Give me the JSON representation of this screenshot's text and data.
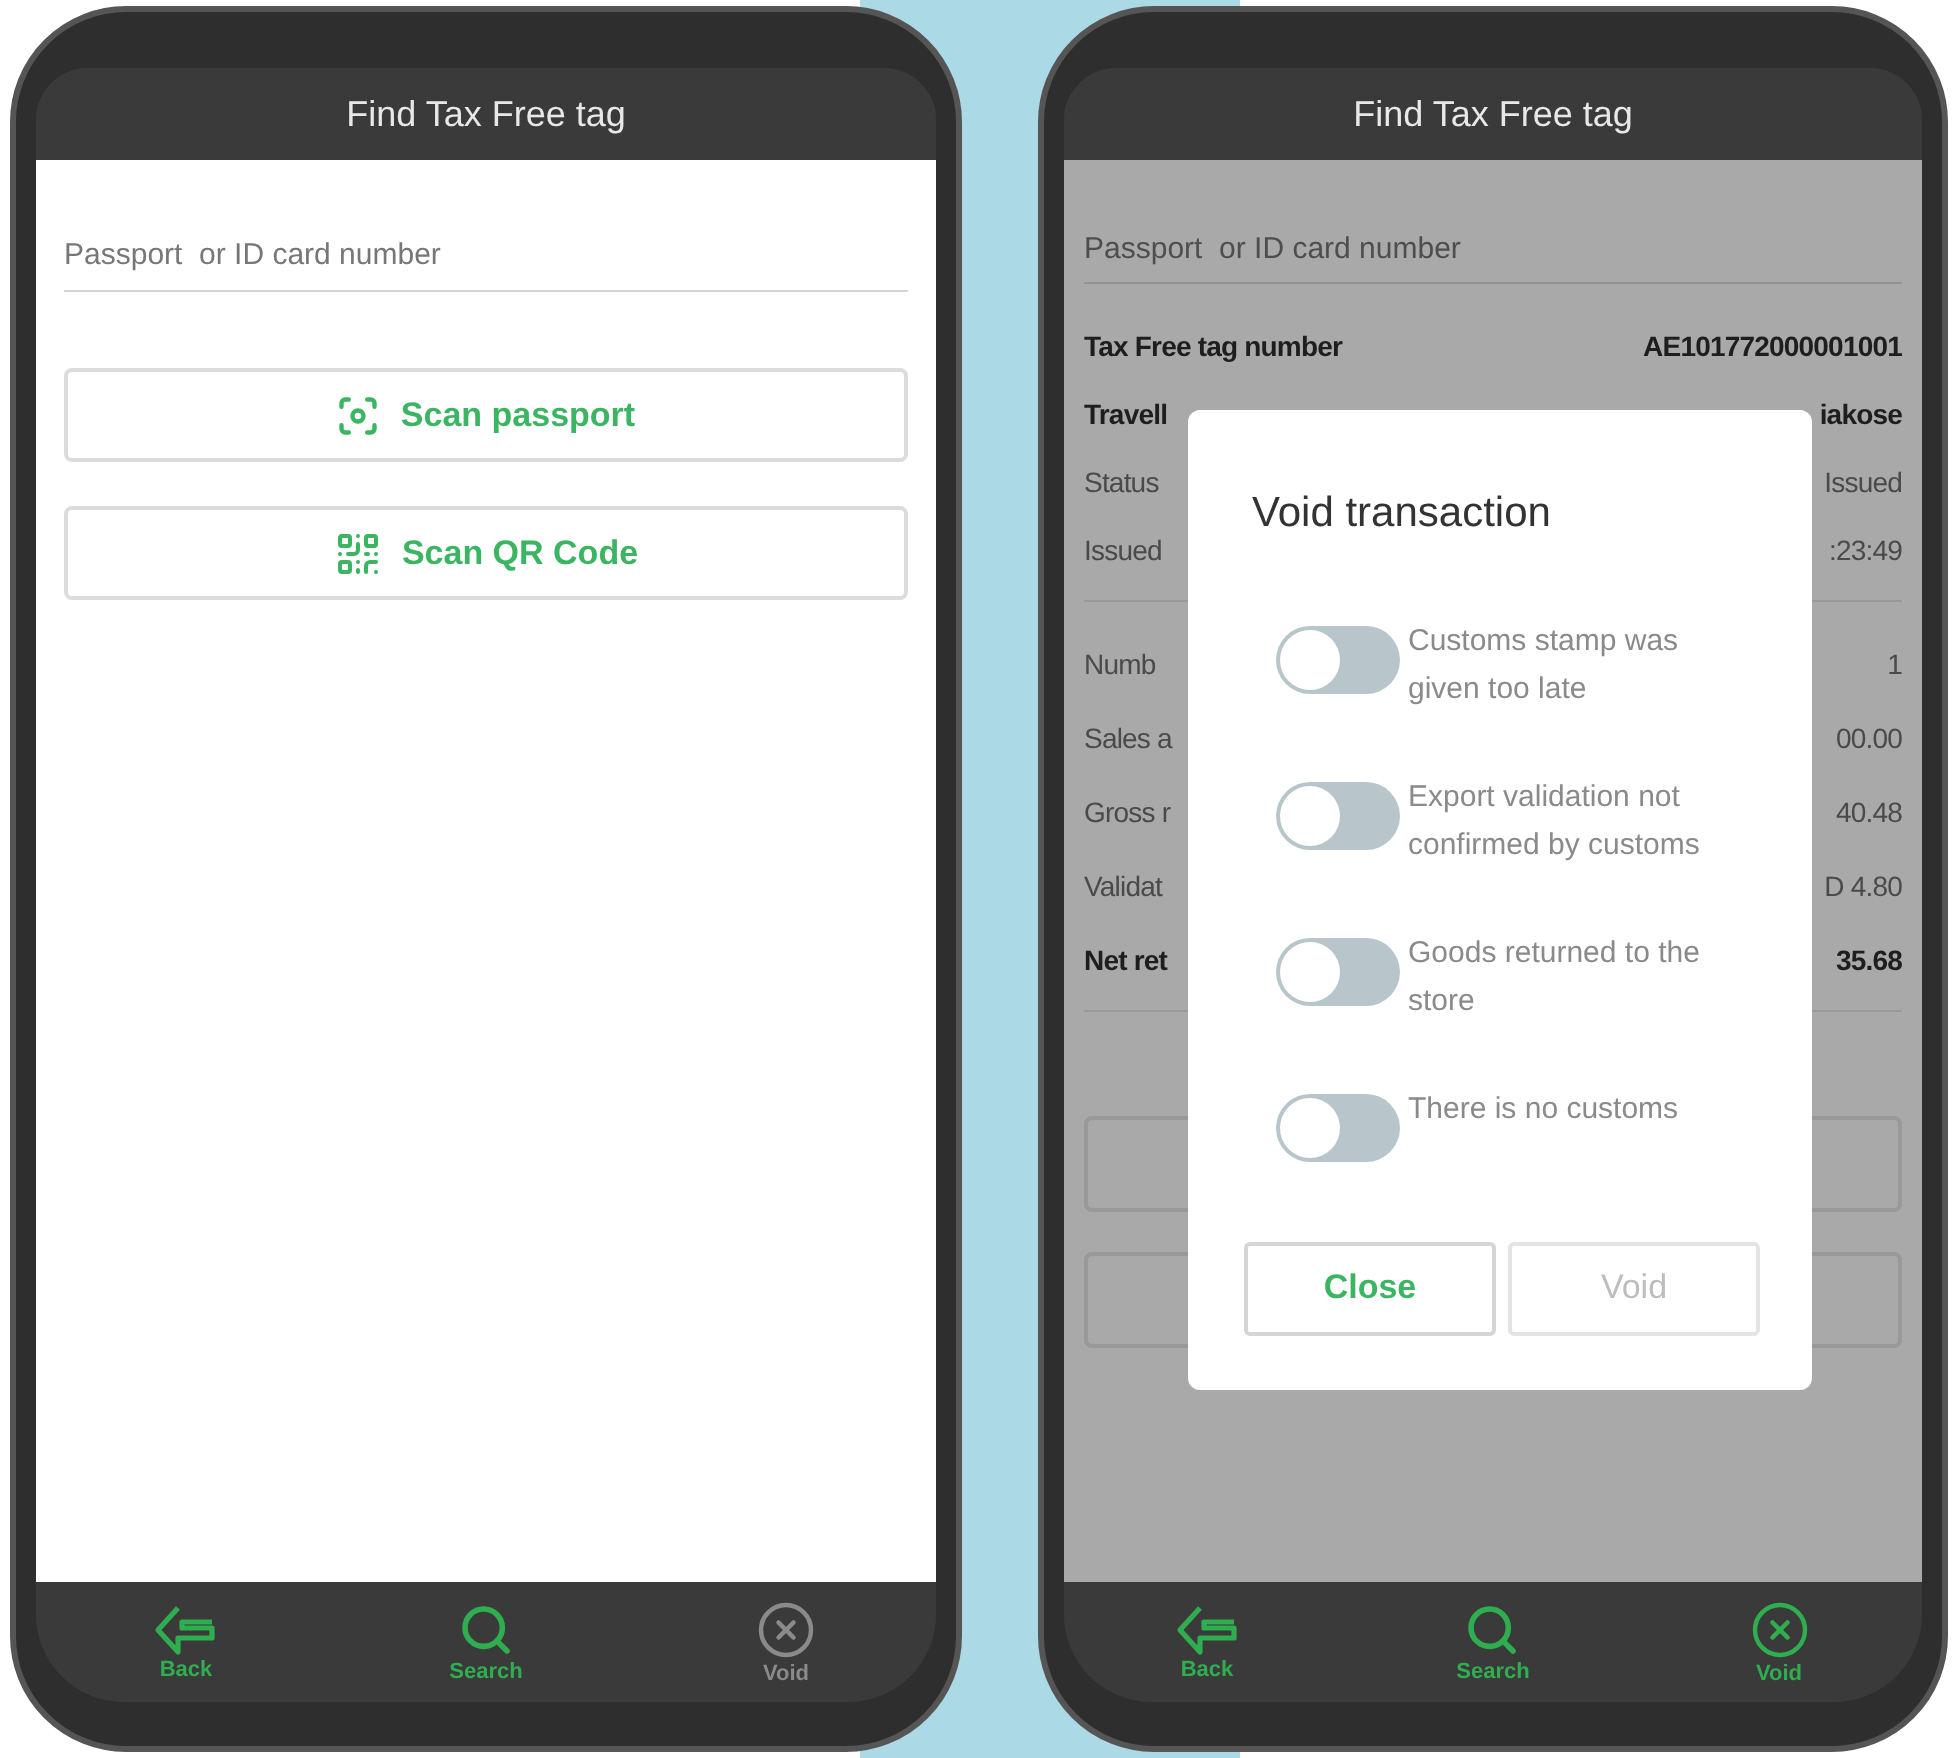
{
  "left_screen": {
    "title": "Find Tax Free tag",
    "search": {
      "placeholder": "Passport  or ID card number"
    },
    "buttons": [
      {
        "kind": "passport",
        "label": "Scan passport"
      },
      {
        "kind": "qr",
        "label": "Scan QR Code"
      }
    ],
    "nav": [
      {
        "kind": "back",
        "label": "Back",
        "disabled": false
      },
      {
        "kind": "search",
        "label": "Search",
        "disabled": false
      },
      {
        "kind": "void",
        "label": "Void",
        "disabled": true
      }
    ]
  },
  "right_screen": {
    "title": "Find Tax Free tag",
    "search": {
      "placeholder": "Passport  or ID card number"
    },
    "sections": [
      {
        "rows": [
          {
            "label": "Tax Free tag number",
            "value": "AE101772000001001",
            "bold": true
          },
          {
            "label": "Travell",
            "value": "iakose",
            "bold": true
          },
          {
            "label": "Status",
            "value": "Issued",
            "bold": false
          },
          {
            "label": "Issued",
            "value": ":23:49",
            "bold": false
          }
        ]
      },
      {
        "rows": [
          {
            "label": "Numb",
            "value": "1",
            "bold": false
          },
          {
            "label": "Sales a",
            "value": "00.00",
            "bold": false
          },
          {
            "label": "Gross r",
            "value": "40.48",
            "bold": false
          },
          {
            "label": "Validat",
            "value": "D 4.80",
            "bold": false
          },
          {
            "label": "Net ret",
            "value": "35.68",
            "bold": true
          }
        ]
      }
    ],
    "dialog": {
      "title": "Void transaction",
      "options": [
        {
          "label": "Customs stamp was given too late",
          "on": false
        },
        {
          "label": "Export validation not confirmed by customs",
          "on": false
        },
        {
          "label": "Goods returned to the store",
          "on": false
        },
        {
          "label": "There is no customs",
          "on": false
        }
      ],
      "buttons": [
        {
          "label": "Close",
          "disabled": false
        },
        {
          "label": "Void",
          "disabled": true
        }
      ]
    },
    "nav": [
      {
        "kind": "back",
        "label": "Back",
        "disabled": false
      },
      {
        "kind": "search",
        "label": "Search",
        "disabled": false
      },
      {
        "kind": "void",
        "label": "Void",
        "disabled": false
      }
    ]
  }
}
